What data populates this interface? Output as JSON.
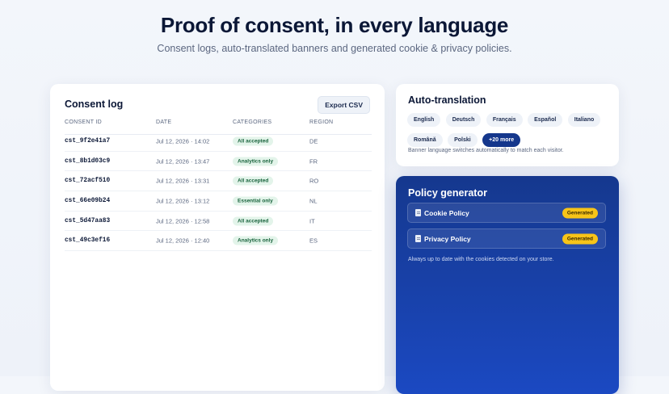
{
  "hero": {
    "title": "Proof of consent, in every language",
    "subtitle": "Consent logs, auto-translated banners and generated cookie & privacy policies."
  },
  "consent_log": {
    "title": "Consent log",
    "export_label": "Export CSV",
    "columns": {
      "id": "CONSENT ID",
      "date": "DATE",
      "categories": "CATEGORIES",
      "region": "REGION"
    },
    "rows": [
      {
        "id": "cst_9f2e41a7",
        "date": "Jul 12, 2026 · 14:02",
        "category": "All accepted",
        "region": "DE"
      },
      {
        "id": "cst_8b1d03c9",
        "date": "Jul 12, 2026 · 13:47",
        "category": "Analytics only",
        "region": "FR"
      },
      {
        "id": "cst_72acf510",
        "date": "Jul 12, 2026 · 13:31",
        "category": "All accepted",
        "region": "RO"
      },
      {
        "id": "cst_66e09b24",
        "date": "Jul 12, 2026 · 13:12",
        "category": "Essential only",
        "region": "NL"
      },
      {
        "id": "cst_5d47aa83",
        "date": "Jul 12, 2026 · 12:58",
        "category": "All accepted",
        "region": "IT"
      },
      {
        "id": "cst_49c3ef16",
        "date": "Jul 12, 2026 · 12:40",
        "category": "Analytics only",
        "region": "ES"
      }
    ]
  },
  "auto_translation": {
    "title": "Auto-translation",
    "languages": [
      "English",
      "Deutsch",
      "Français",
      "Español",
      "Italiano",
      "Română",
      "Polski"
    ],
    "more_label": "+20 more",
    "note": "Banner language switches automatically to match each visitor."
  },
  "policy_generator": {
    "title": "Policy generator",
    "policies": [
      {
        "name": "Cookie Policy",
        "status": "Generated"
      },
      {
        "name": "Privacy Policy",
        "status": "Generated"
      }
    ],
    "note": "Always up to date with the cookies detected on your store."
  },
  "colors": {
    "accent": "#15378c",
    "badge": "#f7c418",
    "category_bg": "#e3f4ea"
  }
}
